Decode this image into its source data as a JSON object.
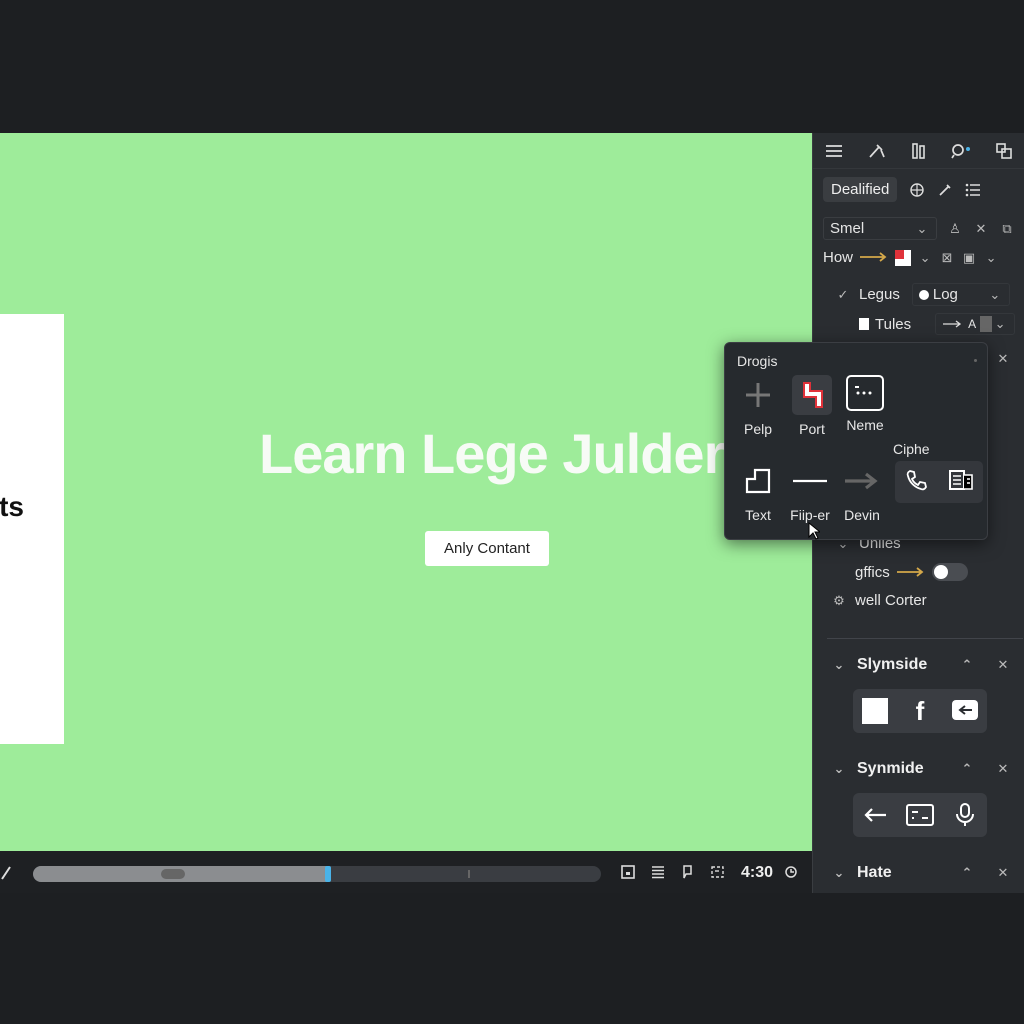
{
  "canvas": {
    "slide_card_text": "ts",
    "headline": "Learn Lege Julder",
    "content_button": "Anly Contant",
    "background": "#9eec9a"
  },
  "timeline": {
    "time": "4:30",
    "progress": 0.52
  },
  "panel": {
    "toolbar_icons": [
      "menu-icon",
      "tools-icon",
      "columns-icon",
      "search-icon",
      "layers-icon"
    ],
    "style_chip": "Dealified",
    "font_select": "Smel",
    "how_label": "How",
    "legus_label": "Legus",
    "log_select": "Log",
    "tules_label": "Tules",
    "tules_value": "A",
    "unlies_label": "Unlies",
    "gffics_label": "gffics",
    "gffics_value": "0",
    "well_corter_label": "well Corter",
    "sections": [
      {
        "title": "Slymside"
      },
      {
        "title": "Synmide"
      },
      {
        "title": "Hate"
      }
    ]
  },
  "popup": {
    "title": "Drogis",
    "tools": [
      {
        "label": "Pelp",
        "icon": "plus-icon"
      },
      {
        "label": "Port",
        "icon": "port-icon"
      },
      {
        "label": "Neme",
        "icon": "frame-icon"
      },
      {
        "label": "Text",
        "icon": "text-shape-icon"
      },
      {
        "label": "Fiip-er",
        "icon": "line-icon"
      },
      {
        "label": "Devin",
        "icon": "arrow-right-icon"
      }
    ],
    "ciphe_label": "Ciphe"
  },
  "colors": {
    "accent": "#4ab3e8",
    "arrow": "#d4a84a",
    "port_red": "#e0323a"
  }
}
